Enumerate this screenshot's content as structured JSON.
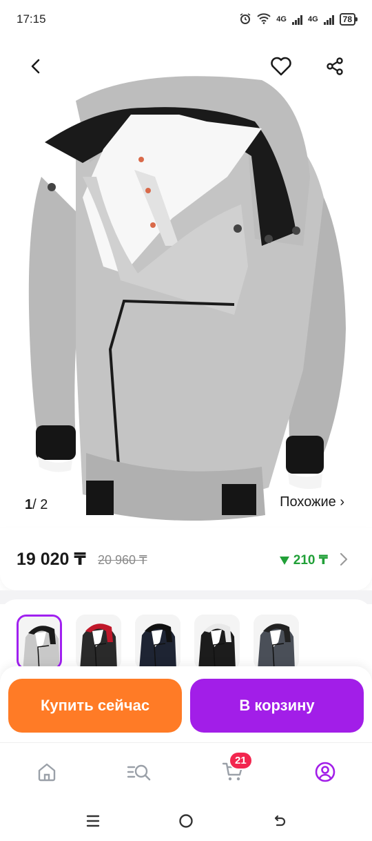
{
  "status_bar": {
    "time": "17:15",
    "network_1": "4G",
    "network_2": "4G",
    "battery": "78"
  },
  "gallery": {
    "current": "1",
    "total": "/ 2",
    "similar_label": "Похожие ›"
  },
  "price": {
    "current": "19 020 ₸",
    "old": "20 960 ₸",
    "cashback": "210 ₸",
    "cashback_color": "#21a038"
  },
  "variants": {
    "items": [
      {
        "name": "grey-white",
        "selected": true,
        "colors": [
          "#c8c8c8",
          "#1a1a1a",
          "#ffffff"
        ]
      },
      {
        "name": "black-red",
        "selected": false,
        "colors": [
          "#2a2a2a",
          "#c0182a",
          "#ffffff"
        ]
      },
      {
        "name": "navy-white",
        "selected": false,
        "colors": [
          "#1e2433",
          "#111111",
          "#ffffff"
        ]
      },
      {
        "name": "black-white",
        "selected": false,
        "colors": [
          "#1c1c1c",
          "#e8e8e8",
          "#ffffff"
        ]
      },
      {
        "name": "darkgrey",
        "selected": false,
        "colors": [
          "#4a4f58",
          "#222222",
          "#ffffff"
        ]
      }
    ]
  },
  "actions": {
    "buy_now": "Купить сейчас",
    "add_to_cart": "В корзину",
    "buy_color": "#ff7b26",
    "cart_color": "#a21ee8"
  },
  "bottom_nav": {
    "cart_count": "21",
    "accent": "#a21ee8",
    "icons": [
      "home-icon",
      "search-catalog-icon",
      "cart-icon",
      "profile-icon"
    ]
  }
}
